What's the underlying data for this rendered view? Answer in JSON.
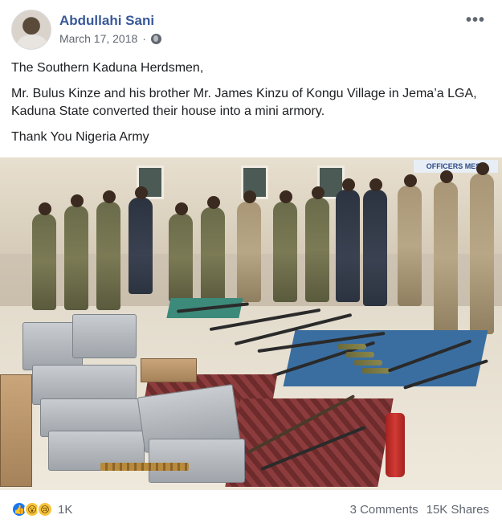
{
  "post": {
    "author": "Abdullahi Sani",
    "date": "March 17, 2018",
    "privacy_icon": "globe-icon",
    "more_icon": "more-options-icon",
    "paragraphs": [
      "The Southern Kaduna Herdsmen,",
      "Mr. Bulus Kinze and his brother Mr. James Kinzu of Kongu Village in Jema’a LGA, Kaduna State converted their house into a mini armory.",
      "Thank You Nigeria Army"
    ],
    "photo": {
      "sign_text": "OFFICERS MESS"
    }
  },
  "footer": {
    "reactions": [
      "like-icon",
      "wow-icon",
      "sad-icon"
    ],
    "reaction_count": "1K",
    "comments": "3 Comments",
    "shares": "15K Shares"
  },
  "colors": {
    "author_link": "#385898",
    "secondary_text": "#606770",
    "like_blue": "#1877f2"
  }
}
